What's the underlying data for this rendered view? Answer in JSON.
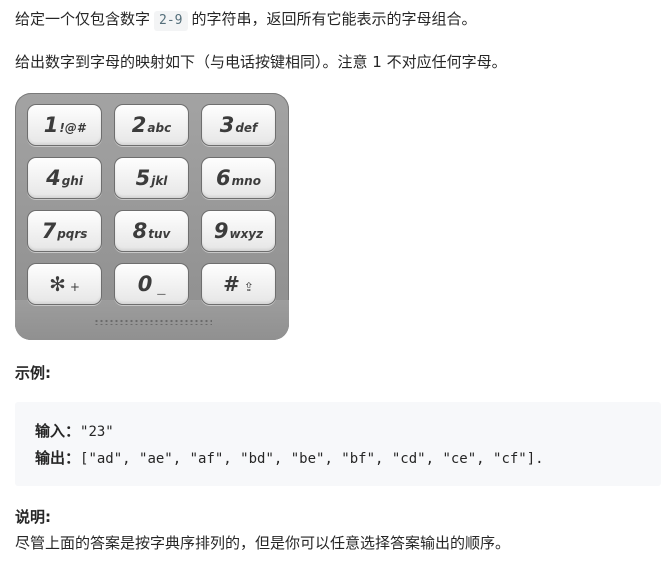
{
  "intro": {
    "before_code": "给定一个仅包含数字",
    "code": "2-9",
    "after_code": "的字符串，返回所有它能表示的字母组合。"
  },
  "mapping_text": "给出数字到字母的映射如下（与电话按键相同）。注意 1 不对应任何字母。",
  "keypad": {
    "keys": [
      {
        "digit": "1",
        "letters": "!@#"
      },
      {
        "digit": "2",
        "letters": "abc"
      },
      {
        "digit": "3",
        "letters": "def"
      },
      {
        "digit": "4",
        "letters": "ghi"
      },
      {
        "digit": "5",
        "letters": "jkl"
      },
      {
        "digit": "6",
        "letters": "mno"
      },
      {
        "digit": "7",
        "letters": "pqrs"
      },
      {
        "digit": "8",
        "letters": "tuv"
      },
      {
        "digit": "9",
        "letters": "wxyz"
      },
      {
        "digit": "✻",
        "letters": "+"
      },
      {
        "digit": "0",
        "letters": "_"
      },
      {
        "digit": "#",
        "letters": "⇪"
      }
    ]
  },
  "example": {
    "heading": "示例:",
    "input_label": "输入：",
    "input_value": "\"23\"",
    "output_label": "输出：",
    "output_value": "[\"ad\", \"ae\", \"af\", \"bd\", \"be\", \"bf\", \"cd\", \"ce\", \"cf\"]."
  },
  "note": {
    "heading": "说明:",
    "text": "尽管上面的答案是按字典序排列的，但是你可以任意选择答案输出的顺序。"
  }
}
